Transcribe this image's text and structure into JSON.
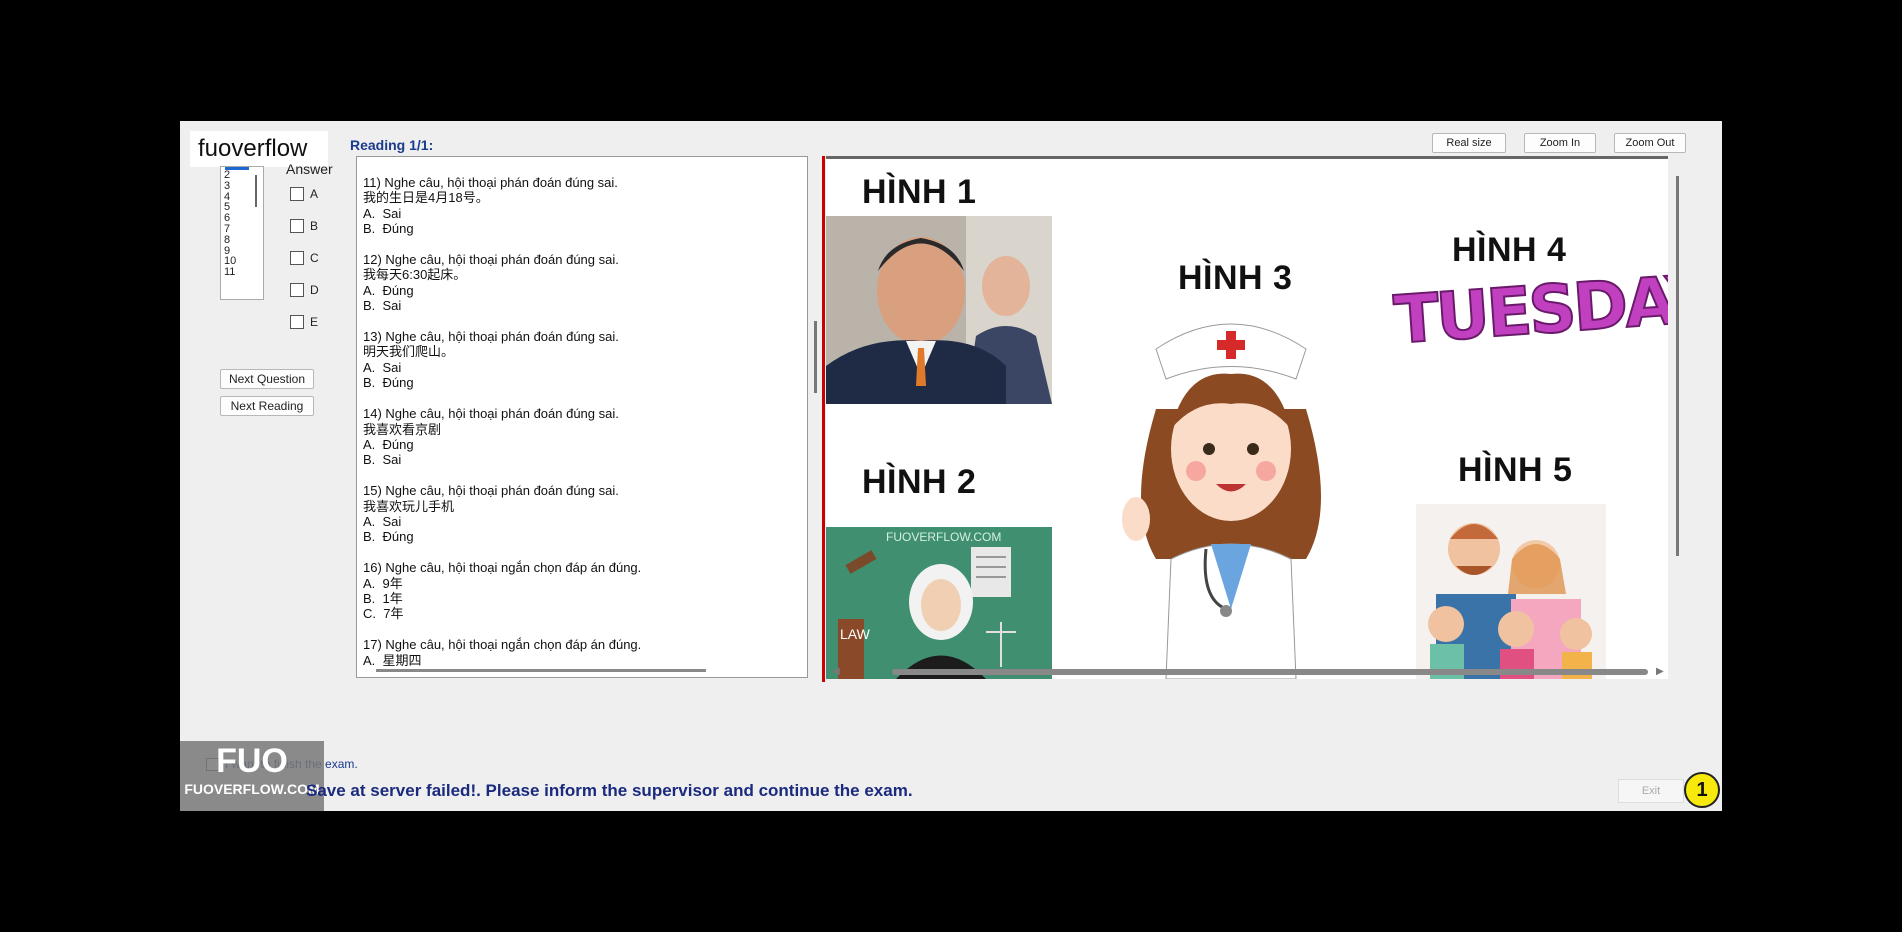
{
  "brand": {
    "name": "fuoverflow",
    "logo_big": "FUO",
    "logo_small": "FUOVERFLOW.COM"
  },
  "sidebar": {
    "answer_label": "Answer",
    "question_numbers": [
      "2",
      "3",
      "4",
      "5",
      "6",
      "7",
      "8",
      "9",
      "10",
      "11"
    ],
    "options": [
      "A",
      "B",
      "C",
      "D",
      "E"
    ],
    "next_question": "Next Question",
    "next_reading": "Next Reading"
  },
  "reading": {
    "title": "Reading 1/1:",
    "text": "11) Nghe câu, hội thoại phán đoán đúng sai.\n我的生日是4月18号。\nA.  Sai\nB.  Đúng\n\n12) Nghe câu, hội thoại phán đoán đúng sai.\n我每天6:30起床。\nA.  Đúng\nB.  Sai\n\n13) Nghe câu, hội thoại phán đoán đúng sai.\n明天我们爬山。\nA.  Sai\nB.  Đúng\n\n14) Nghe câu, hội thoại phán đoán đúng sai.\n我喜欢看京剧\nA.  Đúng\nB.  Sai\n\n15) Nghe câu, hội thoại phán đoán đúng sai.\n我喜欢玩儿手机\nA.  Sai\nB.  Đúng\n\n16) Nghe câu, hội thoại ngắn chọn đáp án đúng.\nA.  9年\nB.  1年\nC.  7年\n\n17) Nghe câu, hội thoại ngắn chọn đáp án đúng.\nA.  星期四"
  },
  "toolbar": {
    "real_size": "Real size",
    "zoom_in": "Zoom In",
    "zoom_out": "Zoom Out"
  },
  "image": {
    "labels": [
      "HÌNH 1",
      "HÌNH 2",
      "HÌNH 3",
      "HÌNH 4",
      "HÌNH 5"
    ],
    "tuesday": "TUESDAY",
    "watermark": "FUOVERFLOW.COM",
    "law_text": "LAW"
  },
  "footer": {
    "finish_label": "I want to finish the exam.",
    "error": "Save at server failed!. Please inform the supervisor and continue the exam.",
    "exit": "Exit",
    "badge": "1"
  }
}
